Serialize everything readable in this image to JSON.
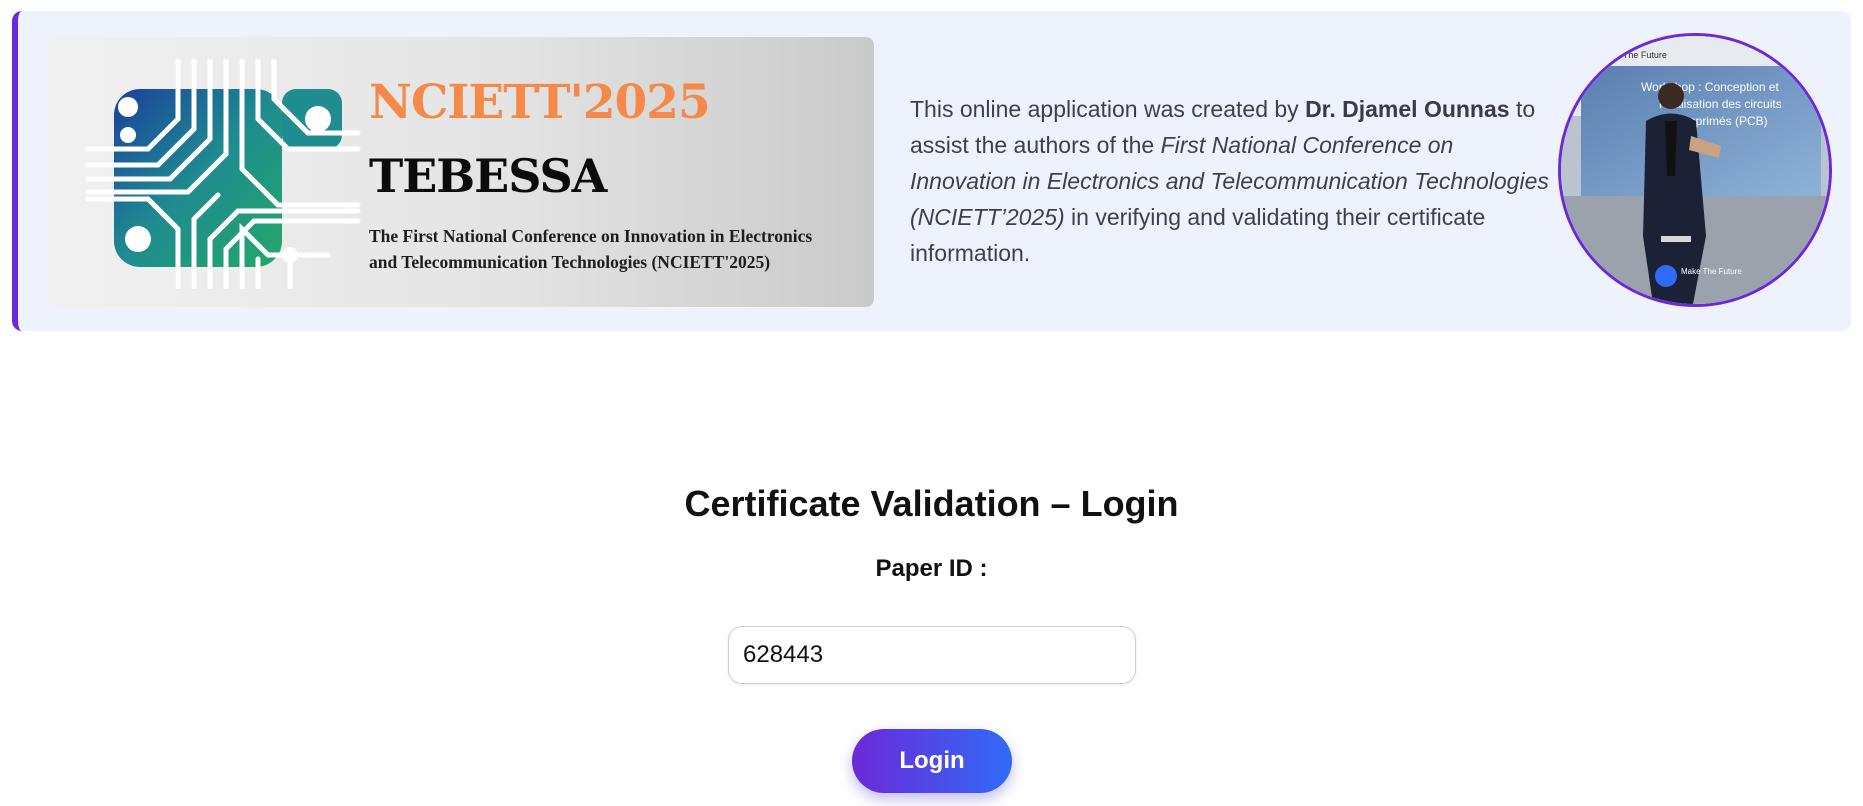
{
  "banner": {
    "logo": {
      "title": "NCIETT'2025",
      "city": "TEBESSA",
      "desc_line1": "The First National Conference on Innovation in Electronics",
      "desc_line2": "and Telecommunication Technologies (NCIETT'2025)"
    },
    "intro": {
      "part1": "This online application was created by ",
      "author": "Dr. Djamel Ounnas",
      "part2": " to assist the authors of the ",
      "conference": "First National Conference on Innovation in Electronics and Telecommunication Technologies (NCIETT’2025)",
      "part3": " in verifying and validating their certificate information."
    },
    "photo": {
      "top_caption": "ke The Future",
      "screen_text_1": "Workshop : Conception et",
      "screen_text_2": "Réalisation des circuits",
      "screen_text_3": "imprimés (PCB)",
      "badge": "Make The Future"
    }
  },
  "form": {
    "title": "Certificate Validation – Login",
    "paper_id_label": "Paper ID :",
    "paper_id_value": "628443",
    "login_label": "Login"
  },
  "colors": {
    "accent": "#6d28d9",
    "button_gradient_end": "#2f6bf7",
    "logo_orange": "#f5894a",
    "banner_bg": "#eef2fd"
  },
  "icons": {
    "logo": "circuit-chip-logo",
    "photo": "speaker-photo"
  }
}
